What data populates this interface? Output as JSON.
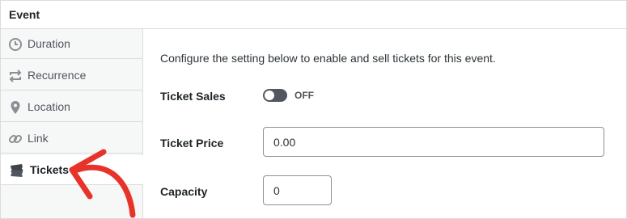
{
  "panel": {
    "title": "Event"
  },
  "sidebar": {
    "items": [
      {
        "label": "Duration",
        "icon": "clock-icon"
      },
      {
        "label": "Recurrence",
        "icon": "recurrence-icon"
      },
      {
        "label": "Location",
        "icon": "location-pin-icon"
      },
      {
        "label": "Link",
        "icon": "link-icon"
      },
      {
        "label": "Tickets",
        "icon": "tickets-icon",
        "active": true
      }
    ]
  },
  "main": {
    "intro": "Configure the setting below to enable and sell tickets for this event.",
    "ticket_sales": {
      "label": "Ticket Sales",
      "state_text": "OFF"
    },
    "ticket_price": {
      "label": "Ticket Price",
      "value": "0.00"
    },
    "capacity": {
      "label": "Capacity",
      "value": "0"
    }
  },
  "colors": {
    "annotation_arrow": "#e8332a",
    "toggle_off": "#50575e"
  }
}
